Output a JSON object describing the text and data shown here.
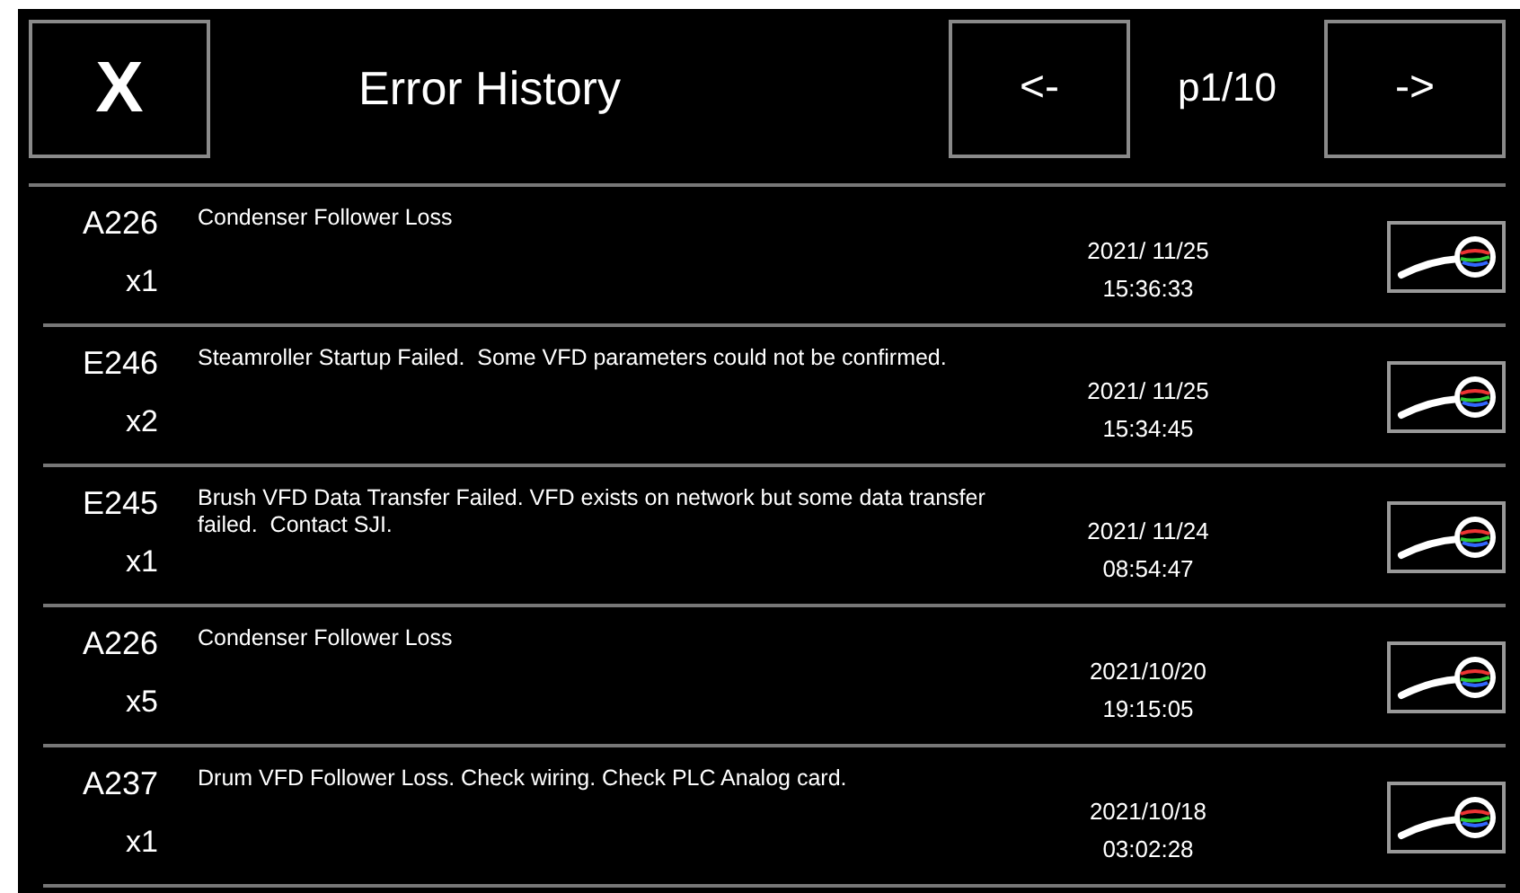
{
  "header": {
    "close_label": "X",
    "title": "Error History",
    "prev_label": "<-",
    "page": "p1/10",
    "next_label": "->"
  },
  "errors": [
    {
      "code": "A226",
      "count": "x1",
      "message": "Condenser Follower Loss",
      "date": "2021/ 11/25",
      "time": "15:36:33"
    },
    {
      "code": "E246",
      "count": "x2",
      "message": "Steamroller Startup Failed.  Some VFD parameters could not be confirmed.",
      "date": "2021/ 11/25",
      "time": "15:34:45"
    },
    {
      "code": "E245",
      "count": "x1",
      "message": "Brush VFD Data Transfer Failed. VFD exists on network but some data transfer failed.  Contact SJI.",
      "date": "2021/ 11/24",
      "time": "08:54:47"
    },
    {
      "code": "A226",
      "count": "x5",
      "message": "Condenser Follower Loss",
      "date": "2021/10/20",
      "time": "19:15:05"
    },
    {
      "code": "A237",
      "count": "x1",
      "message": "Drum VFD Follower Loss. Check wiring. Check PLC Analog card.",
      "date": "2021/10/18",
      "time": "03:02:28"
    }
  ]
}
